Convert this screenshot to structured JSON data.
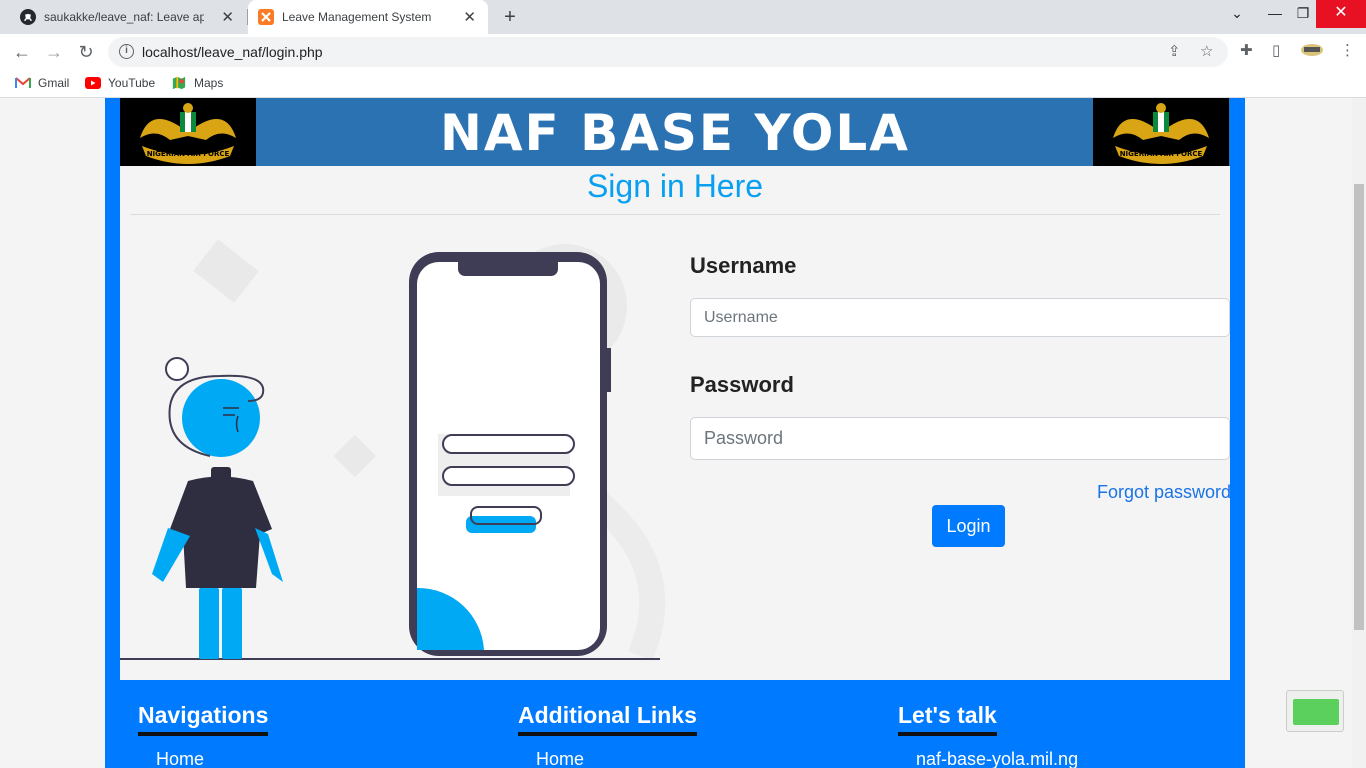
{
  "browser": {
    "tabs": [
      {
        "label": "saukakke/leave_naf: Leave app fo",
        "icon": "github-icon"
      },
      {
        "label": "Leave Management System",
        "icon": "xampp-icon"
      }
    ],
    "url": "localhost/leave_naf/login.php",
    "bookmarks": [
      {
        "label": "Gmail",
        "icon": "gmail-icon"
      },
      {
        "label": "YouTube",
        "icon": "youtube-icon"
      },
      {
        "label": "Maps",
        "icon": "maps-icon"
      }
    ]
  },
  "page": {
    "banner_title": "NAF BASE YOLA",
    "emblem_text": "NIGERIAN AIR FORCE",
    "heading": "Sign in Here",
    "username_label": "Username",
    "username_placeholder": "Username",
    "password_label": "Password",
    "password_placeholder": "Password",
    "forgot_password": "Forgot password",
    "login_button": "Login"
  },
  "footer": {
    "columns": [
      {
        "title": "Navigations",
        "first_link": "Home"
      },
      {
        "title": "Additional Links",
        "first_link": "Home"
      },
      {
        "title": "Let's talk",
        "first_link": "naf-base-yola.mil.ng"
      }
    ]
  },
  "colors": {
    "frame_blue": "#007bff",
    "banner_blue": "#2b72b3",
    "heading_blue": "#0aa0f0",
    "illustration_accent": "#00a9f4",
    "illustration_dark": "#2f2e41"
  }
}
